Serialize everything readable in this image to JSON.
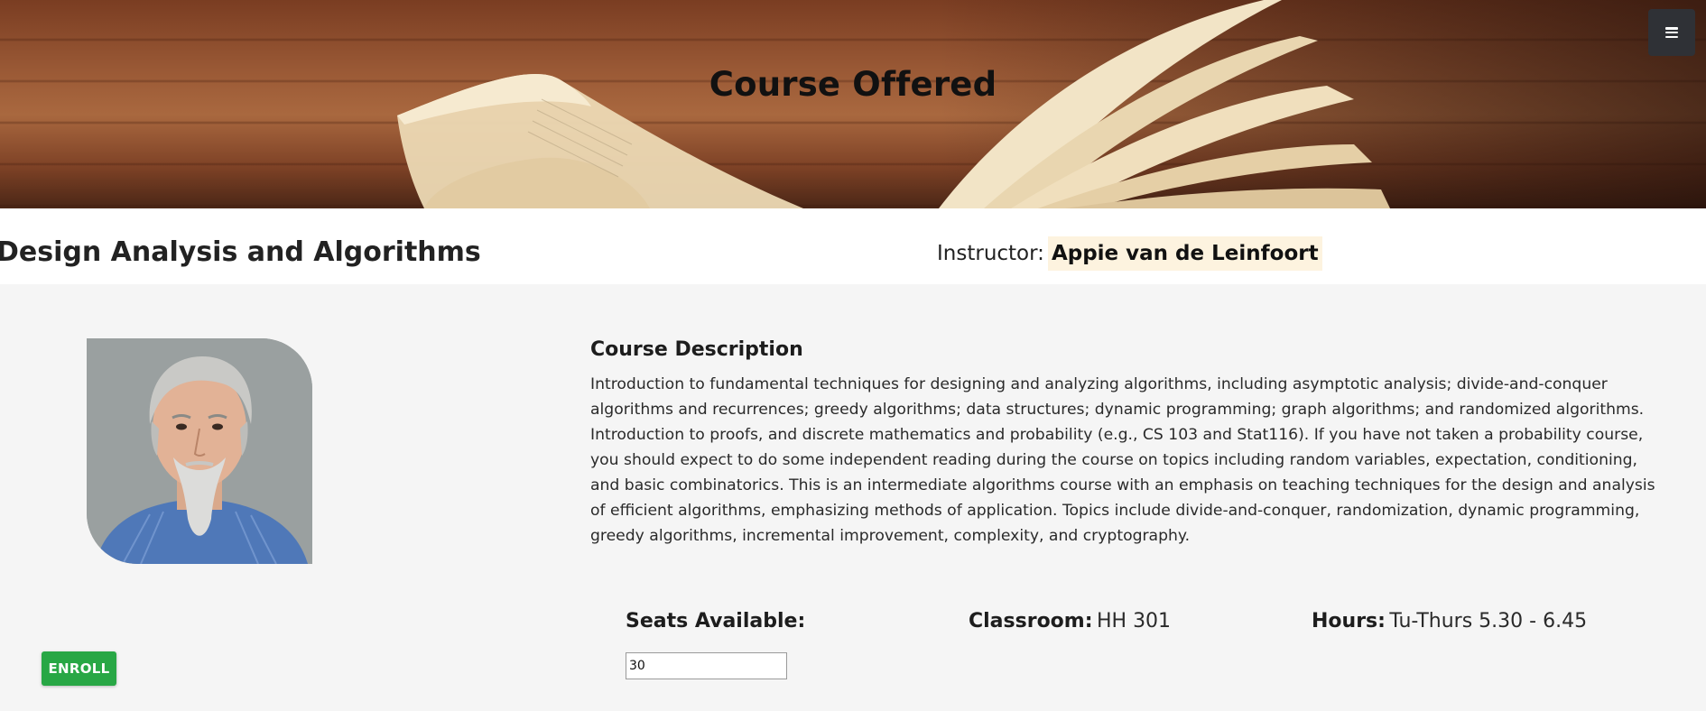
{
  "banner": {
    "title": "Course Offered",
    "menu_icon": "hamburger-menu-icon"
  },
  "course": {
    "title": "Design Analysis and Algorithms",
    "instructor_label": "Instructor:",
    "instructor_name": "Appie van de Leinfoort"
  },
  "description": {
    "heading": "Course Description",
    "text": "Introduction to fundamental techniques for designing and analyzing algorithms, including asymptotic analysis; divide-and-conquer algorithms and recurrences; greedy algorithms; data structures; dynamic programming; graph algorithms; and randomized algorithms. Introduction to proofs, and discrete mathematics and probability (e.g., CS 103 and Stat116). If you have not taken a probability course, you should expect to do some independent reading during the course on topics including random variables, expectation, conditioning, and basic combinatorics. This is an intermediate algorithms course with an emphasis on teaching techniques for the design and analysis of efficient algorithms, emphasizing methods of application. Topics include divide-and-conquer, randomization, dynamic programming, greedy algorithms, incremental improvement, complexity, and cryptography."
  },
  "details": {
    "seats_label": "Seats Available:",
    "seats_value": "30",
    "classroom_label": "Classroom:",
    "classroom_value": "HH 301",
    "hours_label": "Hours:",
    "hours_value": "Tu-Thurs 5.30 - 6.45"
  },
  "actions": {
    "enroll_label": "ENROLL"
  },
  "colors": {
    "enroll_button": "#28a745",
    "menu_button": "#2f3136",
    "instructor_highlight": "#fdf3df",
    "content_background": "#f5f5f5"
  }
}
